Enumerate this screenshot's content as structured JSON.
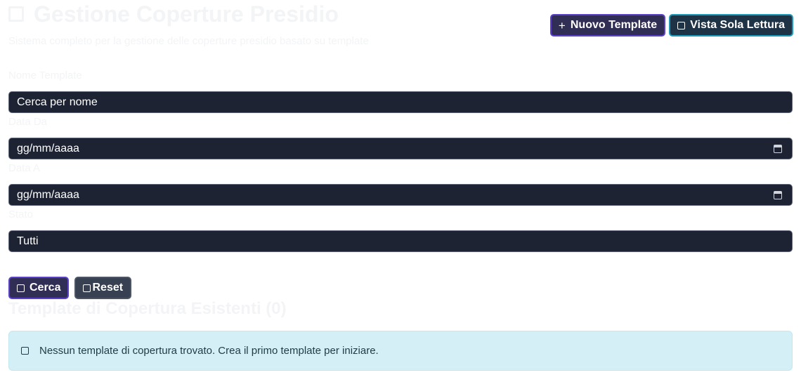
{
  "header": {
    "title": "Gestione Coperture Presidio",
    "title_icon": "checkbox-icon",
    "subtitle": "Sistema completo per la gestione delle coperture presidio basato su template"
  },
  "actions": {
    "new_template_icon": "+",
    "new_template_label": "Nuovo Template",
    "readonly_label": "Vista Sola Lettura"
  },
  "filters": {
    "name_label": "Nome Template",
    "name_placeholder": "Cerca per nome",
    "date_from_label": "Data Da",
    "date_from_value": "gg/mm/aaaa",
    "date_to_label": "Data A",
    "date_to_value": "gg/mm/aaaa",
    "status_label": "Stato",
    "status_value": "Tutti"
  },
  "search": {
    "search_label": "Cerca",
    "reset_label": "Reset"
  },
  "templates": {
    "section_title": "Template di Copertura Esistenti (0)",
    "empty_message": "Nessun template di copertura trovato. Crea il primo template per iniziare."
  },
  "colors": {
    "primary_button": "#312e55",
    "primary_border": "#5b40c9",
    "info_border": "#1e99b8",
    "input_bg": "#1d2333",
    "alert_bg": "#d4eff5"
  }
}
